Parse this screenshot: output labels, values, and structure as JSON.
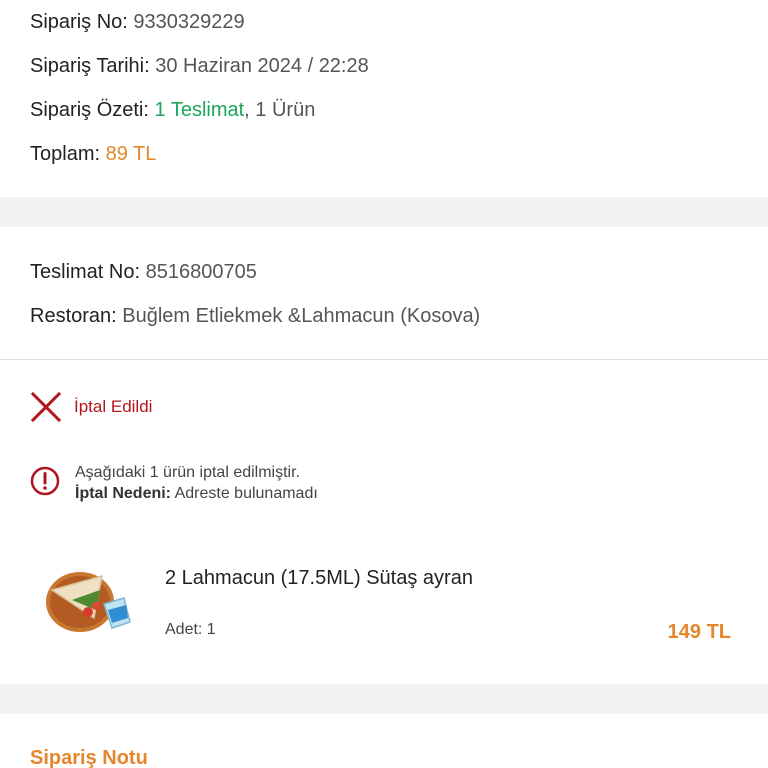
{
  "order": {
    "number_label": "Sipariş No:",
    "number_value": "9330329229",
    "date_label": "Sipariş Tarihi:",
    "date_value": "30 Haziran 2024 / 22:28",
    "summary_label": "Sipariş Özeti:",
    "summary_deliveries": "1 Teslimat",
    "summary_separator": ",",
    "summary_items": "1 Ürün",
    "total_label": "Toplam:",
    "total_value": "89 TL"
  },
  "delivery": {
    "number_label": "Teslimat No:",
    "number_value": "8516800705",
    "restaurant_label": "Restoran:",
    "restaurant_value": "Buğlem Etliekmek &Lahmacun (Kosova)"
  },
  "status": {
    "icon": "close-icon",
    "text": "İptal Edildi",
    "color": "#b3151d"
  },
  "notice": {
    "icon": "info-icon",
    "line1": "Aşağıdaki 1 ürün iptal edilmiştir.",
    "reason_label": "İptal Nedeni:",
    "reason_value": "Adreste bulunamadı"
  },
  "product": {
    "name": "2 Lahmacun (17.5ML) Sütaş ayran",
    "qty": "Adet: 1",
    "price": "149 TL"
  },
  "note": {
    "title": "Sipariş Notu"
  },
  "colors": {
    "accent_orange": "#e5862a",
    "accent_green": "#1ba65a",
    "cancel_red": "#b3151d",
    "section_gap": "#f2f2f2"
  }
}
